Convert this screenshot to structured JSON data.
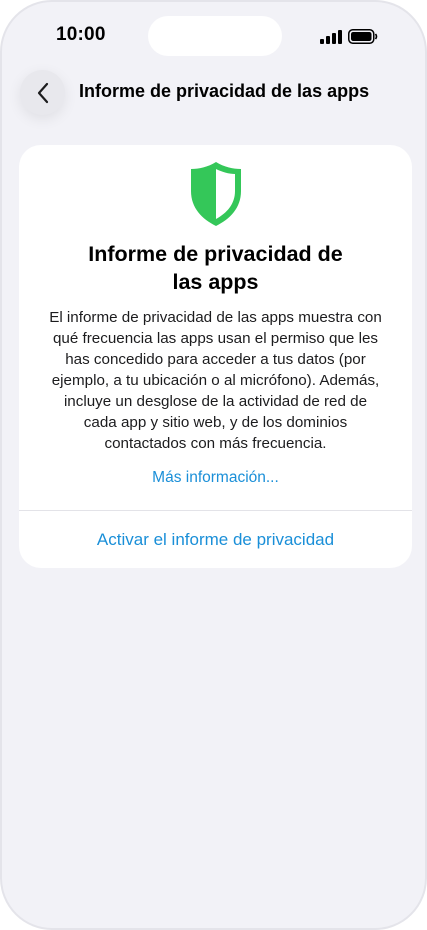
{
  "status_bar": {
    "time": "10:00"
  },
  "nav": {
    "title": "Informe de privacidad de las apps",
    "back_icon": "chevron-left-icon"
  },
  "card": {
    "icon": "shield-icon",
    "icon_color": "#34c759",
    "title_line1": "Informe de privacidad de",
    "title_line2": "las apps",
    "body_lines": [
      "El informe de privacidad de las apps muestra con",
      "qué frecuencia las apps usan el permiso que les",
      "has concedido para acceder a tus datos (por",
      "ejemplo, a tu ubicación o al micrófono). Además,",
      "incluye un desglose de la actividad de red de",
      "cada app y sitio web, y de los dominios",
      "contactados con más frecuencia."
    ],
    "more_info_link": "Más información...",
    "activate_button": "Activar el informe de privacidad"
  },
  "colors": {
    "accent": "#1a8fd8",
    "background": "#f2f2f7",
    "card": "#ffffff"
  }
}
